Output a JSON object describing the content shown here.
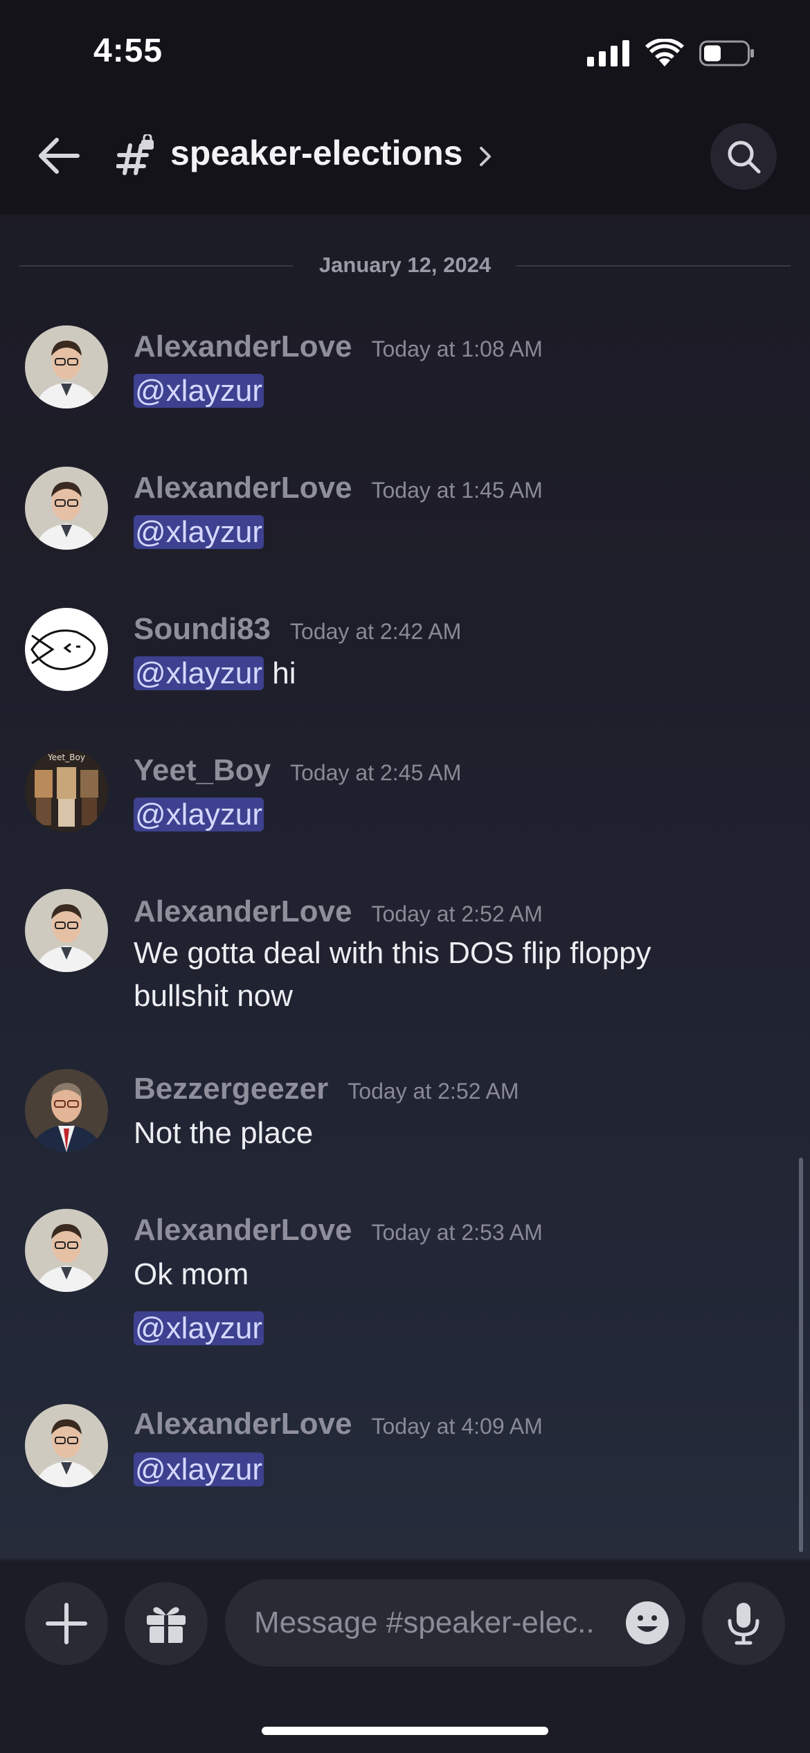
{
  "status_bar": {
    "time": "4:55",
    "battery_level": 0.4
  },
  "header": {
    "channel_name": "speaker-elections",
    "icons": {
      "back": "back-arrow-icon",
      "channel": "hash-lock-icon",
      "search": "search-icon"
    }
  },
  "date_divider": "January 12, 2024",
  "messages": [
    {
      "user": "AlexanderLove",
      "time": "Today at 1:08 AM",
      "mention": "@xlayzur",
      "text": ""
    },
    {
      "user": "AlexanderLove",
      "time": "Today at 1:45 AM",
      "mention": "@xlayzur",
      "text": ""
    },
    {
      "user": "Soundi83",
      "time": "Today at 2:42 AM",
      "mention": "@xlayzur",
      "text": "hi"
    },
    {
      "user": "Yeet_Boy",
      "time": "Today at 2:45 AM",
      "mention": "@xlayzur",
      "text": "",
      "avatar_caption": "Yeet_Boy"
    },
    {
      "user": "AlexanderLove",
      "time": "Today at 2:52 AM",
      "lines": [
        "We gotta deal with this DOS flip floppy",
        "bullshit now"
      ]
    },
    {
      "user": "Bezzergeezer",
      "time": "Today at 2:52 AM",
      "text": "Not the place"
    },
    {
      "user": "AlexanderLove",
      "time": "Today at 2:53 AM",
      "text": "Ok mom",
      "mention": "@xlayzur"
    },
    {
      "user": "AlexanderLove",
      "time": "Today at 4:09 AM",
      "mention": "@xlayzur",
      "text": ""
    }
  ],
  "composer": {
    "placeholder": "Message #speaker-elec..",
    "icons": {
      "add": "plus-icon",
      "gift": "gift-icon",
      "emoji": "emoji-icon",
      "mic": "microphone-icon"
    }
  },
  "colors": {
    "mention_bg": "#3d418f",
    "mention_text": "#d5d8ff",
    "header_bg": "#141319"
  }
}
